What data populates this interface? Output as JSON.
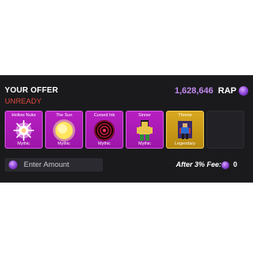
{
  "offer": {
    "title": "YOUR OFFER",
    "status": "UNREADY",
    "rap_value": "1,628,646",
    "rap_label": "RAP"
  },
  "items": [
    {
      "name": "Hollow Nuke",
      "rarity": "Mythic",
      "icon": "hollow-nuke-icon"
    },
    {
      "name": "The Sun",
      "rarity": "Mythic",
      "icon": "sun-icon"
    },
    {
      "name": "Cursed Ink",
      "rarity": "Mythic",
      "icon": "cursed-ink-icon"
    },
    {
      "name": "Sinner",
      "rarity": "Mythic",
      "icon": "sinner-avatar-icon"
    },
    {
      "name": "Throne",
      "rarity": "Legendary",
      "icon": "throne-avatar-icon"
    }
  ],
  "amount_input": {
    "placeholder": "Enter Amount"
  },
  "fee": {
    "label": "After 3% Fee:",
    "value": "0"
  },
  "colors": {
    "mythic": "#b81fc2",
    "legendary": "#d9a820",
    "rap_accent": "#c38af0",
    "unready": "#e0483c",
    "panel": "#1a1a1d"
  }
}
